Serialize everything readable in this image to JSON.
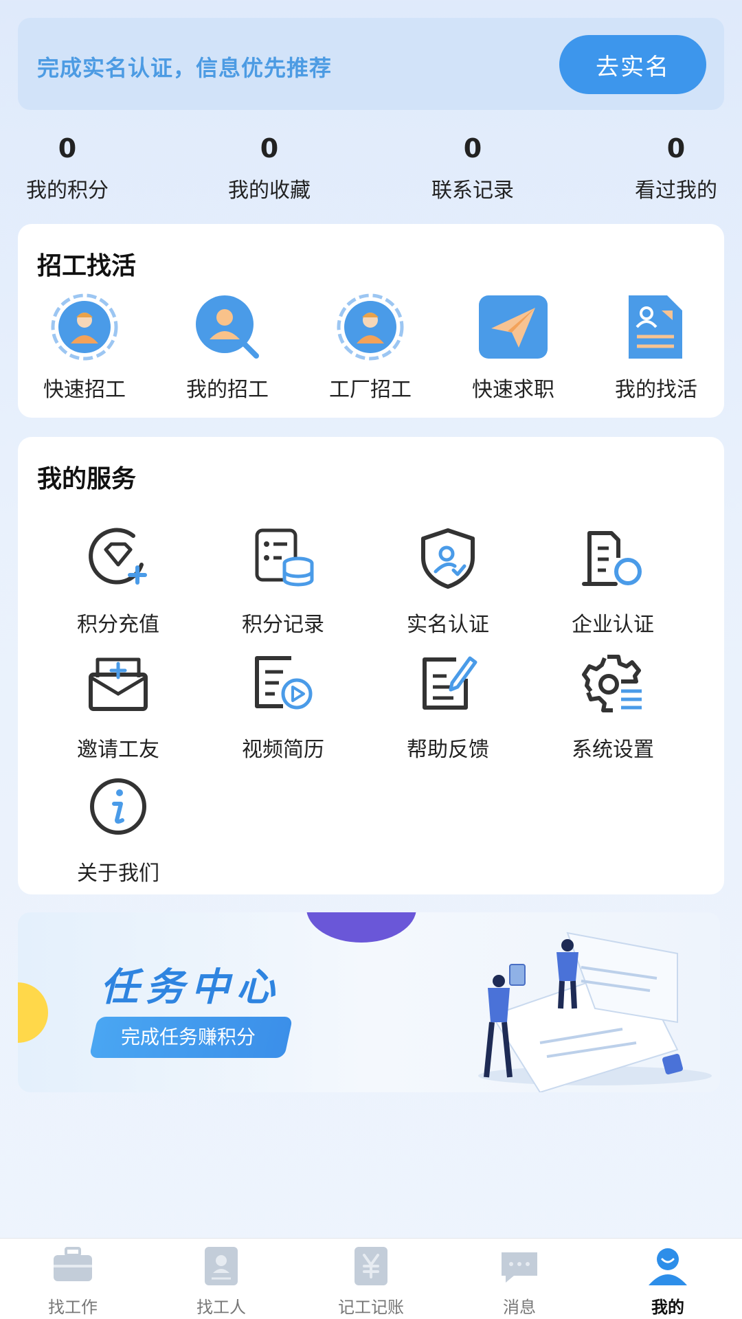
{
  "banner": {
    "text": "完成实名认证，信息优先推荐",
    "button_label": "去实名"
  },
  "stats": [
    {
      "value": "0",
      "label": "我的积分"
    },
    {
      "value": "0",
      "label": "我的收藏"
    },
    {
      "value": "0",
      "label": "联系记录"
    },
    {
      "value": "0",
      "label": "看过我的"
    }
  ],
  "job_section": {
    "title": "招工找活",
    "items": [
      {
        "label": "快速招工",
        "icon": "worker-badge-icon"
      },
      {
        "label": "我的招工",
        "icon": "user-search-icon"
      },
      {
        "label": "工厂招工",
        "icon": "worker-badge-icon"
      },
      {
        "label": "快速求职",
        "icon": "paper-plane-icon"
      },
      {
        "label": "我的找活",
        "icon": "resume-document-icon"
      }
    ]
  },
  "service_section": {
    "title": "我的服务",
    "items": [
      {
        "label": "积分充值",
        "icon": "diamond-plus-icon"
      },
      {
        "label": "积分记录",
        "icon": "list-coins-icon"
      },
      {
        "label": "实名认证",
        "icon": "shield-user-icon"
      },
      {
        "label": "企业认证",
        "icon": "building-search-icon"
      },
      {
        "label": "邀请工友",
        "icon": "envelope-plus-icon"
      },
      {
        "label": "视频简历",
        "icon": "video-document-icon"
      },
      {
        "label": "帮助反馈",
        "icon": "edit-document-icon"
      },
      {
        "label": "系统设置",
        "icon": "gear-icon"
      },
      {
        "label": "关于我们",
        "icon": "info-icon"
      }
    ]
  },
  "task_banner": {
    "title": "任务中心",
    "subtitle": "完成任务赚积分"
  },
  "tabbar": {
    "items": [
      {
        "label": "找工作",
        "icon": "briefcase-icon",
        "active": false
      },
      {
        "label": "找工人",
        "icon": "worker-card-icon",
        "active": false
      },
      {
        "label": "记工记账",
        "icon": "yuan-ledger-icon",
        "active": false
      },
      {
        "label": "消息",
        "icon": "chat-bubble-icon",
        "active": false
      },
      {
        "label": "我的",
        "icon": "profile-icon",
        "active": true
      }
    ]
  },
  "colors": {
    "accent": "#3d96ec",
    "icon_dark": "#333333",
    "icon_blue": "#4a9be8"
  }
}
